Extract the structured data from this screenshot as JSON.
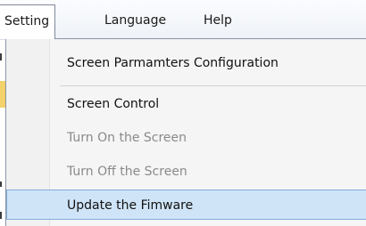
{
  "menubar": {
    "items": [
      {
        "label": "Setting"
      },
      {
        "label": "Language"
      },
      {
        "label": "Help"
      }
    ]
  },
  "setting_menu": {
    "items": [
      {
        "label": "Screen Parmamters Configuration",
        "enabled": true
      },
      {
        "label": "Screen Control",
        "enabled": true
      },
      {
        "label": "Turn On the Screen",
        "enabled": false
      },
      {
        "label": "Turn Off the Screen",
        "enabled": false
      },
      {
        "label": "Update the Fimware",
        "enabled": true,
        "highlighted": true
      }
    ]
  },
  "colors": {
    "highlight": "#cfe4f7",
    "highlight_border": "#84acd9",
    "disabled_text": "#8a8a8a"
  }
}
